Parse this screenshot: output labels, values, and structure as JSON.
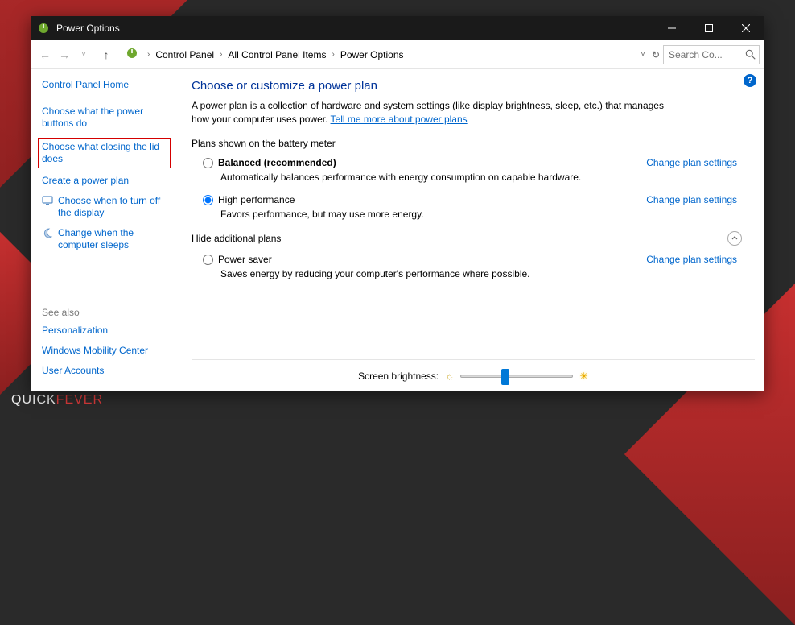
{
  "titlebar": {
    "title": "Power Options"
  },
  "breadcrumb": {
    "c1": "Control Panel",
    "c2": "All Control Panel Items",
    "c3": "Power Options"
  },
  "search": {
    "placeholder": "Search Co..."
  },
  "sidebar": {
    "home": "Control Panel Home",
    "l1": "Choose what the power buttons do",
    "l2": "Choose what closing the lid does",
    "l3": "Create a power plan",
    "l4": "Choose when to turn off the display",
    "l5": "Change when the computer sleeps",
    "see_also": "See also",
    "sa1": "Personalization",
    "sa2": "Windows Mobility Center",
    "sa3": "User Accounts"
  },
  "main": {
    "heading": "Choose or customize a power plan",
    "desc_pre": "A power plan is a collection of hardware and system settings (like display brightness, sleep, etc.) that manages how your computer uses power. ",
    "desc_link": "Tell me more about power plans",
    "section1": "Plans shown on the battery meter",
    "plan1_name": "Balanced (recommended)",
    "plan1_desc": "Automatically balances performance with energy consumption on capable hardware.",
    "plan2_name": "High performance",
    "plan2_desc": "Favors performance, but may use more energy.",
    "change_link": "Change plan settings",
    "section2": "Hide additional plans",
    "plan3_name": "Power saver",
    "plan3_desc": "Saves energy by reducing your computer's performance where possible.",
    "footer_label": "Screen brightness:"
  }
}
